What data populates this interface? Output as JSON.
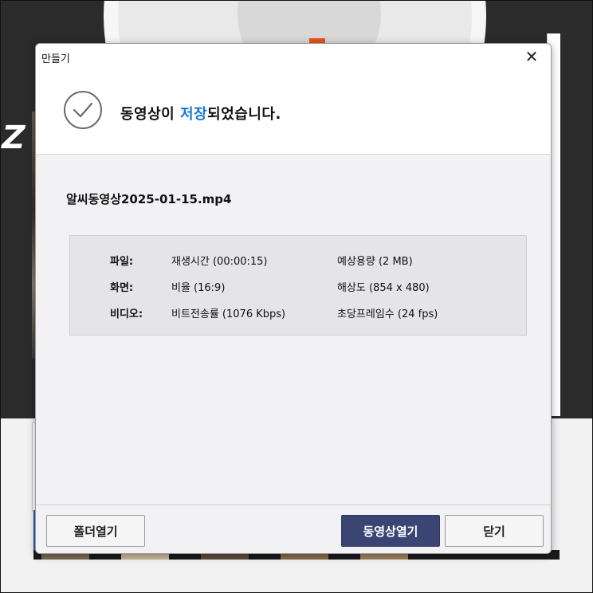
{
  "dialog": {
    "title": "만들기",
    "close_label": "✕",
    "message_prefix": "동영상이 ",
    "message_highlight": "저장",
    "message_suffix": "되었습니다.",
    "filename": "알씨동영상2025-01-15.mp4",
    "info": {
      "rows": [
        {
          "label": "파일:",
          "col1": "재생시간 (00:00:15)",
          "col2": "예상용량 (2 MB)"
        },
        {
          "label": "화면:",
          "col1": "비율 (16:9)",
          "col2": "해상도 (854 x 480)"
        },
        {
          "label": "비디오:",
          "col1": "비트전송률 (1076 Kbps)",
          "col2": "초당프레임수 (24 fps)"
        }
      ]
    },
    "buttons": {
      "open_folder": "폴더열기",
      "open_video": "동영상열기",
      "close": "닫기"
    }
  },
  "colors": {
    "highlight": "#1976d2",
    "primary_button": "#3a4574",
    "check_icon": "#6b6b6b"
  },
  "icons": {
    "status": "check-circle-icon",
    "close": "close-icon"
  }
}
